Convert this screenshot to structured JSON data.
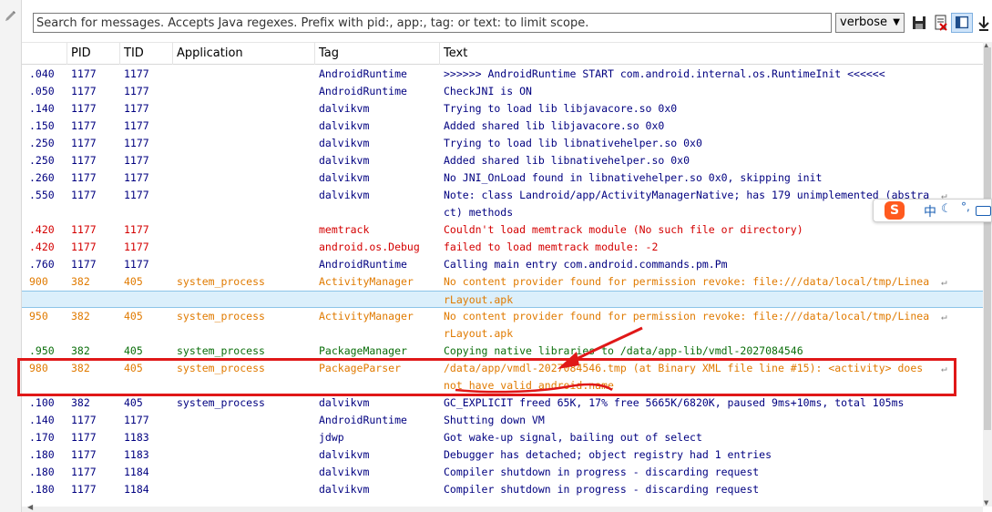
{
  "search": {
    "placeholder": "Search for messages. Accepts Java regexes. Prefix with pid:, app:, tag: or text: to limit scope.",
    "value": ""
  },
  "level_select": {
    "value": "verbose"
  },
  "columns": [
    "",
    "PID",
    "TID",
    "Application",
    "Tag",
    "Text"
  ],
  "colors": {
    "verbose": "#000080",
    "info": "#0a6e0a",
    "warn": "#e07a00",
    "error": "#d40000",
    "selection": "#dbeffb",
    "annotation": "#e01818"
  },
  "rows": [
    {
      "time": ".040",
      "pid": "1177",
      "tid": "1177",
      "app": "",
      "tag": "AndroidRuntime",
      "text": ">>>>>> AndroidRuntime START com.android.internal.os.RuntimeInit <<<<<<",
      "level": "D"
    },
    {
      "time": ".050",
      "pid": "1177",
      "tid": "1177",
      "app": "",
      "tag": "AndroidRuntime",
      "text": "CheckJNI is ON",
      "level": "D"
    },
    {
      "time": ".140",
      "pid": "1177",
      "tid": "1177",
      "app": "",
      "tag": "dalvikvm",
      "text": "Trying to load lib libjavacore.so 0x0",
      "level": "D"
    },
    {
      "time": ".150",
      "pid": "1177",
      "tid": "1177",
      "app": "",
      "tag": "dalvikvm",
      "text": "Added shared lib libjavacore.so 0x0",
      "level": "D"
    },
    {
      "time": ".250",
      "pid": "1177",
      "tid": "1177",
      "app": "",
      "tag": "dalvikvm",
      "text": "Trying to load lib libnativehelper.so 0x0",
      "level": "D"
    },
    {
      "time": ".250",
      "pid": "1177",
      "tid": "1177",
      "app": "",
      "tag": "dalvikvm",
      "text": "Added shared lib libnativehelper.so 0x0",
      "level": "D"
    },
    {
      "time": ".260",
      "pid": "1177",
      "tid": "1177",
      "app": "",
      "tag": "dalvikvm",
      "text": "No JNI_OnLoad found in libnativehelper.so 0x0, skipping init",
      "level": "D"
    },
    {
      "time": ".550",
      "pid": "1177",
      "tid": "1177",
      "app": "",
      "tag": "dalvikvm",
      "text": "Note: class Landroid/app/ActivityManagerNative; has 179 unimplemented (abstra",
      "level": "D",
      "wrap": true
    },
    {
      "time": "",
      "pid": "",
      "tid": "",
      "app": "",
      "tag": "",
      "text": "ct) methods",
      "level": "D"
    },
    {
      "time": ".420",
      "pid": "1177",
      "tid": "1177",
      "app": "",
      "tag": "memtrack",
      "text": "Couldn't load memtrack module (No such file or directory)",
      "level": "E"
    },
    {
      "time": ".420",
      "pid": "1177",
      "tid": "1177",
      "app": "",
      "tag": "android.os.Debug",
      "text": "failed to load memtrack module: -2",
      "level": "E"
    },
    {
      "time": ".760",
      "pid": "1177",
      "tid": "1177",
      "app": "",
      "tag": "AndroidRuntime",
      "text": "Calling main entry com.android.commands.pm.Pm",
      "level": "D"
    },
    {
      "time": "900",
      "pid": "382",
      "tid": "405",
      "app": "system_process",
      "tag": "ActivityManager",
      "text": "No content provider found for permission revoke: file:///data/local/tmp/Linea",
      "level": "W",
      "wrap": true
    },
    {
      "time": "",
      "pid": "",
      "tid": "",
      "app": "",
      "tag": "",
      "text": "rLayout.apk",
      "level": "W",
      "selected": true
    },
    {
      "time": "950",
      "pid": "382",
      "tid": "405",
      "app": "system_process",
      "tag": "ActivityManager",
      "text": "No content provider found for permission revoke: file:///data/local/tmp/Linea",
      "level": "W",
      "wrap": true
    },
    {
      "time": "",
      "pid": "",
      "tid": "",
      "app": "",
      "tag": "",
      "text": "rLayout.apk",
      "level": "W"
    },
    {
      "time": ".950",
      "pid": "382",
      "tid": "405",
      "app": "system_process",
      "tag": "PackageManager",
      "text": "Copying native libraries to /data/app-lib/vmdl-2027084546",
      "level": "I"
    },
    {
      "time": "980",
      "pid": "382",
      "tid": "405",
      "app": "system_process",
      "tag": "PackageParser",
      "text": "/data/app/vmdl-2027084546.tmp (at Binary XML file line #15): <activity> does",
      "level": "W",
      "wrap": true
    },
    {
      "time": "",
      "pid": "",
      "tid": "",
      "app": "",
      "tag": "",
      "text": "not have valid android:name",
      "level": "W"
    },
    {
      "time": ".100",
      "pid": "382",
      "tid": "405",
      "app": "system_process",
      "tag": "dalvikvm",
      "text": "GC_EXPLICIT freed 65K, 17% free 5665K/6820K, paused 9ms+10ms, total 105ms",
      "level": "D"
    },
    {
      "time": ".140",
      "pid": "1177",
      "tid": "1177",
      "app": "",
      "tag": "AndroidRuntime",
      "text": "Shutting down VM",
      "level": "D"
    },
    {
      "time": ".170",
      "pid": "1177",
      "tid": "1183",
      "app": "",
      "tag": "jdwp",
      "text": "Got wake-up signal, bailing out of select",
      "level": "D"
    },
    {
      "time": ".180",
      "pid": "1177",
      "tid": "1183",
      "app": "",
      "tag": "dalvikvm",
      "text": "Debugger has detached; object registry had 1 entries",
      "level": "D"
    },
    {
      "time": ".180",
      "pid": "1177",
      "tid": "1184",
      "app": "",
      "tag": "dalvikvm",
      "text": "Compiler shutdown in progress - discarding request",
      "level": "D"
    },
    {
      "time": ".180",
      "pid": "1177",
      "tid": "1184",
      "app": "",
      "tag": "dalvikvm",
      "text": "Compiler shutdown in progress - discarding request",
      "level": "D"
    }
  ],
  "ime": {
    "logo": "S",
    "mode": "中",
    "moon": "☾",
    "punct": "°,"
  }
}
